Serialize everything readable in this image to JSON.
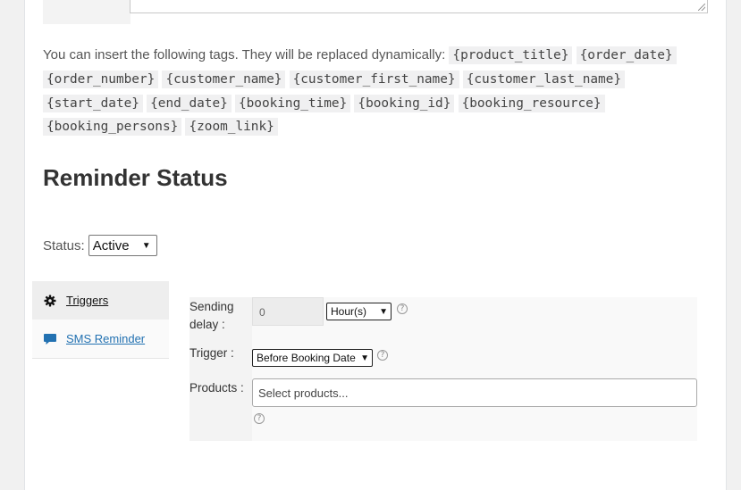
{
  "tags_intro": "You can insert the following tags. They will be replaced dynamically:",
  "tags": [
    "{product_title}",
    "{order_date}",
    "{order_number}",
    "{customer_name}",
    "{customer_first_name}",
    "{customer_last_name}",
    "{start_date}",
    "{end_date}",
    "{booking_time}",
    "{booking_id}",
    "{booking_resource}",
    "{booking_persons}",
    "{zoom_link}"
  ],
  "section_title": "Reminder Status",
  "status": {
    "label": "Status:",
    "value": "Active"
  },
  "tabs": [
    {
      "label": "Triggers",
      "icon": "gear-icon",
      "active": true
    },
    {
      "label": "SMS Reminder",
      "icon": "speech-bubble-icon",
      "active": false
    }
  ],
  "form": {
    "sending_delay": {
      "label": "Sending delay :",
      "value": "0",
      "unit": "Hour(s)"
    },
    "trigger": {
      "label": "Trigger :",
      "value": "Before Booking Date"
    },
    "products": {
      "label": "Products :",
      "placeholder": "Select products..."
    }
  },
  "colors": {
    "link": "#2271b1",
    "panel_bg": "#ffffff",
    "page_bg": "#f1f1f1"
  }
}
